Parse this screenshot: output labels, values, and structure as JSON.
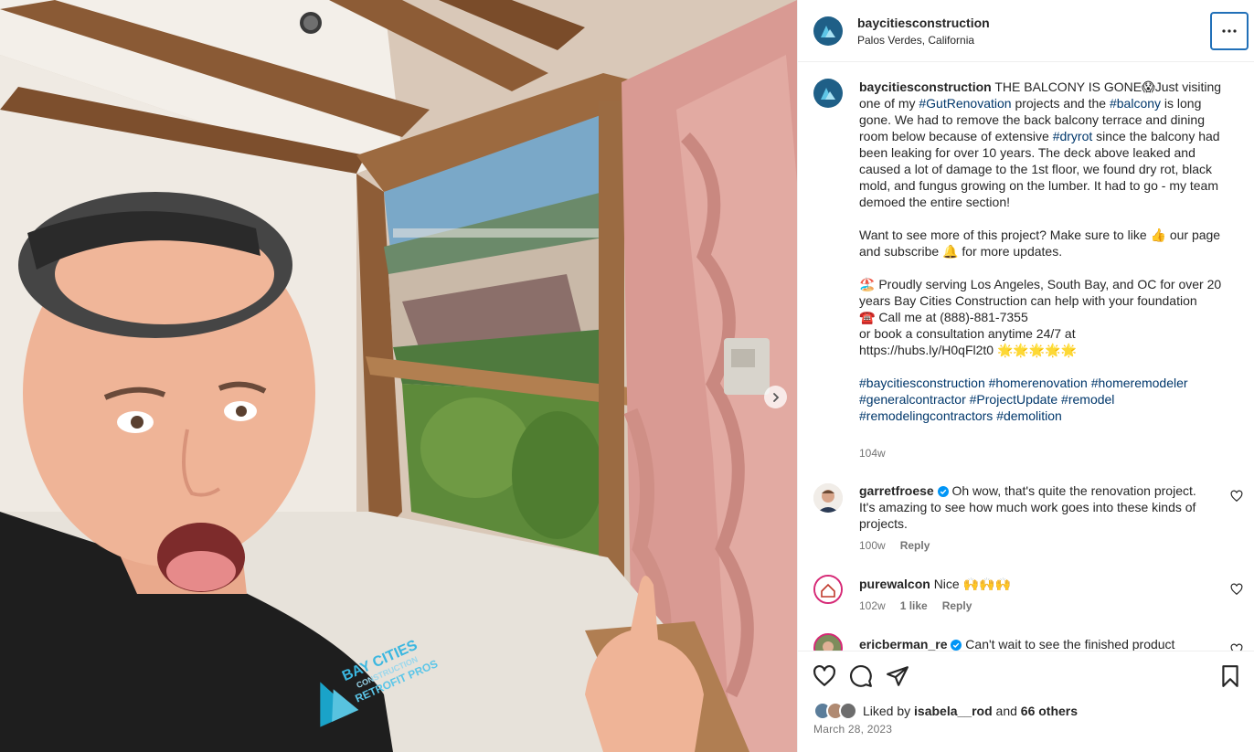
{
  "post": {
    "username": "baycitiesconstruction",
    "location": "Palos Verdes, California",
    "shirt_logo_line1": "BAY CITIES",
    "shirt_logo_line2": "CONSTRUCTION",
    "shirt_logo_line3": "RETROFIT PROS"
  },
  "caption": {
    "username": "baycitiesconstruction",
    "p1_a": "THE BALCONY IS GONE😱Just visiting one of my ",
    "tag_gut": "#GutRenovation",
    "p1_b": " projects and the ",
    "tag_balcony": "#balcony",
    "p1_c": " is long gone. We had to remove the back balcony terrace and dining room below because of extensive ",
    "tag_dryrot": "#dryrot",
    "p1_d": " since the balcony had been leaking for over 10 years. The deck above leaked and caused a lot of damage to the 1st floor, we found dry rot, black mold, and fungus growing on the lumber. It had to go - my team demoed the entire section!",
    "p2": "Want to see more of this project? Make sure to like 👍 our page and subscribe 🔔 for more updates.",
    "p3_line1": "🏖️ Proudly serving Los Angeles, South Bay, and OC for over 20 years Bay Cities Construction can help with your foundation",
    "p3_line2": "☎️ Call me at (888)-881-7355",
    "p3_line3": "or book a consultation anytime 24/7 at",
    "p3_line4": "https://hubs.ly/H0qFl2t0 🌟🌟🌟🌟🌟",
    "hashtags": [
      "#baycitiesconstruction",
      "#homerenovation",
      "#homeremodeler",
      "#generalcontractor",
      "#ProjectUpdate",
      "#remodel",
      "#remodelingcontractors",
      "#demolition"
    ],
    "time": "104w"
  },
  "comments": [
    {
      "username": "garretfroese",
      "verified": true,
      "text": "Oh wow, that's quite the renovation project. It's amazing to see how much work goes into these kinds of projects.",
      "time": "100w",
      "likes": "",
      "reply": "Reply"
    },
    {
      "username": "purewalcon",
      "verified": false,
      "text": "Nice 🙌🙌🙌",
      "time": "102w",
      "likes": "1 like",
      "reply": "Reply"
    },
    {
      "username": "ericberman_re",
      "verified": true,
      "text": "Can't wait to see the finished product",
      "time": "",
      "likes": "",
      "reply": ""
    }
  ],
  "likes": {
    "prefix": "Liked by",
    "user": "isabela__rod",
    "joiner": "and",
    "others": "66 others"
  },
  "date": "March 28, 2023",
  "icons": [
    "ellipsis-icon",
    "heart-icon",
    "comment-icon",
    "share-icon",
    "bookmark-icon",
    "chevron-right-icon",
    "verified-icon"
  ],
  "colors": {
    "accent": "#2170b8",
    "hashtag": "#00376b",
    "meta": "#737373",
    "text": "#262626"
  }
}
